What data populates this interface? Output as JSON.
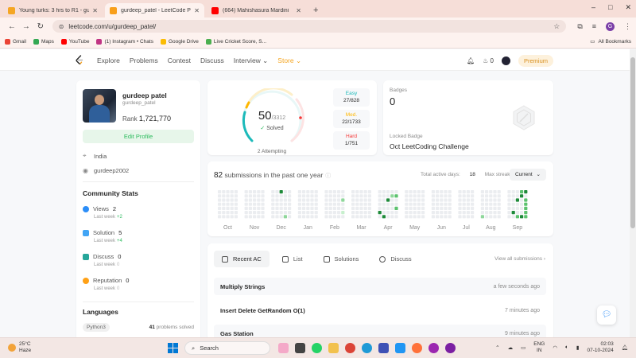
{
  "browser": {
    "tabs": [
      {
        "title": "Young turks: 3 hrs to R1 - gurdeep",
        "favicon_color": "#f5a623",
        "active": false
      },
      {
        "title": "gurdeep_patel - LeetCode Profile",
        "favicon_color": "#f89f1b",
        "active": true
      },
      {
        "title": "(664) Mahishasura Mardini",
        "favicon_color": "#ff0000",
        "active": false
      }
    ],
    "new_tab": "+",
    "window_controls": [
      "–",
      "□",
      "✕"
    ],
    "url": "leetcode.com/u/gurdeep_patel/",
    "profile_initial": "G",
    "bookmarks": [
      {
        "label": "Gmail",
        "color": "#ea4335"
      },
      {
        "label": "Maps",
        "color": "#34a853"
      },
      {
        "label": "YouTube",
        "color": "#ff0000"
      },
      {
        "label": "(1) Instagram • Chats",
        "color": "#c13584"
      },
      {
        "label": "Google Drive",
        "color": "#fbbc04"
      },
      {
        "label": "Live Cricket Score, S...",
        "color": "#4caf50"
      }
    ],
    "all_bookmarks": "All Bookmarks"
  },
  "nav": {
    "links": [
      "Explore",
      "Problems",
      "Contest",
      "Discuss",
      "Interview ⌄",
      "Store ⌄"
    ],
    "points": "0",
    "premium": "Premium"
  },
  "profile": {
    "name": "gurdeep patel",
    "handle": "gurdeep_patel",
    "rank_label": "Rank",
    "rank": "1,721,770",
    "edit_label": "Edit Profile",
    "location": "India",
    "github": "gurdeep2002",
    "community_title": "Community Stats",
    "stats": [
      {
        "label": "Views",
        "value": "2",
        "last": "Last week",
        "delta": "+2",
        "color": "#2c8ef8"
      },
      {
        "label": "Solution",
        "value": "5",
        "last": "Last week",
        "delta": "+4",
        "color": "#42a5f5"
      },
      {
        "label": "Discuss",
        "value": "0",
        "last": "Last week",
        "delta": "0",
        "color": "#26a69a"
      },
      {
        "label": "Reputation",
        "value": "0",
        "last": "Last week",
        "delta": "0",
        "color": "#ffa116"
      }
    ],
    "languages_title": "Languages",
    "language": "Python3",
    "language_count": "41",
    "language_suffix": "problems solved"
  },
  "solved": {
    "count": "50",
    "total": "/3312",
    "label": "Solved",
    "attempting": "2 Attempting",
    "easy": {
      "name": "Easy",
      "count": "27/828",
      "color": "#1cbaba"
    },
    "medium": {
      "name": "Med.",
      "count": "22/1733",
      "color": "#ffb700"
    },
    "hard": {
      "name": "Hard",
      "count": "1/751",
      "color": "#f63737"
    }
  },
  "badges": {
    "label": "Badges",
    "count": "0",
    "locked_label": "Locked Badge",
    "name": "Oct LeetCoding Challenge"
  },
  "submissions": {
    "count": "82",
    "text": "submissions in the past one year",
    "active_label": "Total active days:",
    "active_days": "18",
    "streak_label": "Max streak:",
    "streak": "9",
    "period": "Current",
    "months": [
      "Oct",
      "Nov",
      "Dec",
      "Jan",
      "Feb",
      "Mar",
      "Apr",
      "May",
      "Jun",
      "Jul",
      "Aug",
      "Sep"
    ]
  },
  "recent": {
    "tabs": [
      "Recent AC",
      "List",
      "Solutions",
      "Discuss"
    ],
    "view_all": "View all submissions  ›",
    "rows": [
      {
        "title": "Multiply Strings",
        "ago": "a few seconds ago"
      },
      {
        "title": "Insert Delete GetRandom O(1)",
        "ago": "7 minutes ago"
      },
      {
        "title": "Gas Station",
        "ago": "9 minutes ago"
      }
    ]
  },
  "taskbar": {
    "temp": "25°C",
    "weather": "Haze",
    "search": "Search",
    "lang1": "ENG",
    "lang2": "IN",
    "time": "02:03",
    "date": "07-10-2024"
  }
}
